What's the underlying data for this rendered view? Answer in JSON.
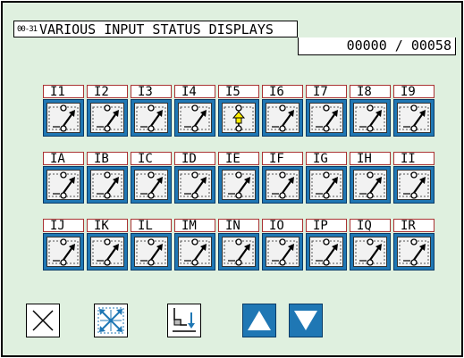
{
  "header": {
    "icon_text": "00-31",
    "title": "VARIOUS INPUT STATUS DISPLAYS",
    "counter": "00000 / 00058"
  },
  "inputs": [
    {
      "label": "I1",
      "state": "off"
    },
    {
      "label": "I2",
      "state": "off"
    },
    {
      "label": "I3",
      "state": "off"
    },
    {
      "label": "I4",
      "state": "off"
    },
    {
      "label": "I5",
      "state": "on"
    },
    {
      "label": "I6",
      "state": "off"
    },
    {
      "label": "I7",
      "state": "off"
    },
    {
      "label": "I8",
      "state": "off"
    },
    {
      "label": "I9",
      "state": "off"
    },
    {
      "label": "IA",
      "state": "off"
    },
    {
      "label": "IB",
      "state": "off"
    },
    {
      "label": "IC",
      "state": "off"
    },
    {
      "label": "ID",
      "state": "off"
    },
    {
      "label": "IE",
      "state": "off"
    },
    {
      "label": "IF",
      "state": "off"
    },
    {
      "label": "IG",
      "state": "off"
    },
    {
      "label": "IH",
      "state": "off"
    },
    {
      "label": "II",
      "state": "off"
    },
    {
      "label": "IJ",
      "state": "off"
    },
    {
      "label": "IK",
      "state": "off"
    },
    {
      "label": "IL",
      "state": "off"
    },
    {
      "label": "IM",
      "state": "off"
    },
    {
      "label": "IN",
      "state": "off"
    },
    {
      "label": "IO",
      "state": "off"
    },
    {
      "label": "IP",
      "state": "off"
    },
    {
      "label": "IQ",
      "state": "off"
    },
    {
      "label": "IR",
      "state": "off"
    }
  ],
  "toolbar": {
    "close_icon": "close-icon",
    "scan_icon": "expand-arrows-icon",
    "presser_icon": "presser-foot-down-icon",
    "up_icon": "triangle-up-icon",
    "down_icon": "triangle-down-icon"
  },
  "colors": {
    "background": "#dff0df",
    "button_blue": "#1f77b4",
    "label_border": "#aa3333",
    "active_indicator": "#ffee00"
  }
}
